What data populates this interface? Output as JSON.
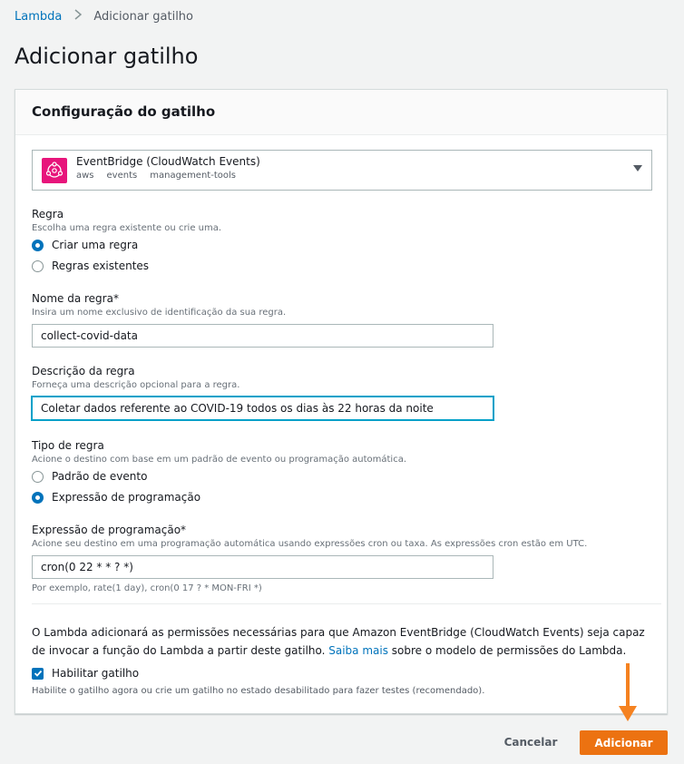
{
  "breadcrumb": {
    "root": "Lambda",
    "current": "Adicionar gatilho"
  },
  "page": {
    "title": "Adicionar gatilho"
  },
  "panel": {
    "title": "Configuração do gatilho",
    "source": {
      "name": "EventBridge (CloudWatch Events)",
      "tags": [
        "aws",
        "events",
        "management-tools"
      ],
      "icon": "eventbridge-icon",
      "icon_color": "#e7157b"
    },
    "rule": {
      "label": "Regra",
      "description": "Escolha uma regra existente ou crie uma.",
      "options": [
        "Criar uma regra",
        "Regras existentes"
      ],
      "selected": "Criar uma regra"
    },
    "rule_name": {
      "label": "Nome da regra*",
      "description": "Insira um nome exclusivo de identificação da sua regra.",
      "value": "collect-covid-data"
    },
    "rule_description": {
      "label": "Descrição da regra",
      "description": "Forneça uma descrição opcional para a regra.",
      "value": "Coletar dados referente ao COVID-19 todos os dias às 22 horas da noite"
    },
    "rule_type": {
      "label": "Tipo de regra",
      "description": "Acione o destino com base em um padrão de evento ou programação automática.",
      "options": [
        "Padrão de evento",
        "Expressão de programação"
      ],
      "selected": "Expressão de programação"
    },
    "schedule": {
      "label": "Expressão de programação*",
      "description": "Acione seu destino em uma programação automática usando expressões cron ou taxa. As expressões cron estão em UTC.",
      "value": "cron(0 22 * * ? *)",
      "example": "Por exemplo, rate(1 day), cron(0 17 ? * MON-FRI *)"
    },
    "permissions": {
      "text_before": "O Lambda adicionará as permissões necessárias para que Amazon EventBridge (CloudWatch Events) seja capaz de invocar a função do Lambda a partir deste gatilho. ",
      "link": "Saiba mais",
      "text_after": " sobre o modelo de permissões do Lambda."
    },
    "enable": {
      "label": "Habilitar gatilho",
      "checked": true,
      "hint": "Habilite o gatilho agora ou crie um gatilho no estado desabilitado para fazer testes (recomendado)."
    }
  },
  "actions": {
    "cancel": "Cancelar",
    "add": "Adicionar"
  },
  "colors": {
    "accent": "#0073bb",
    "primary_button": "#ec7211",
    "annotation_arrow": "#f58220"
  }
}
